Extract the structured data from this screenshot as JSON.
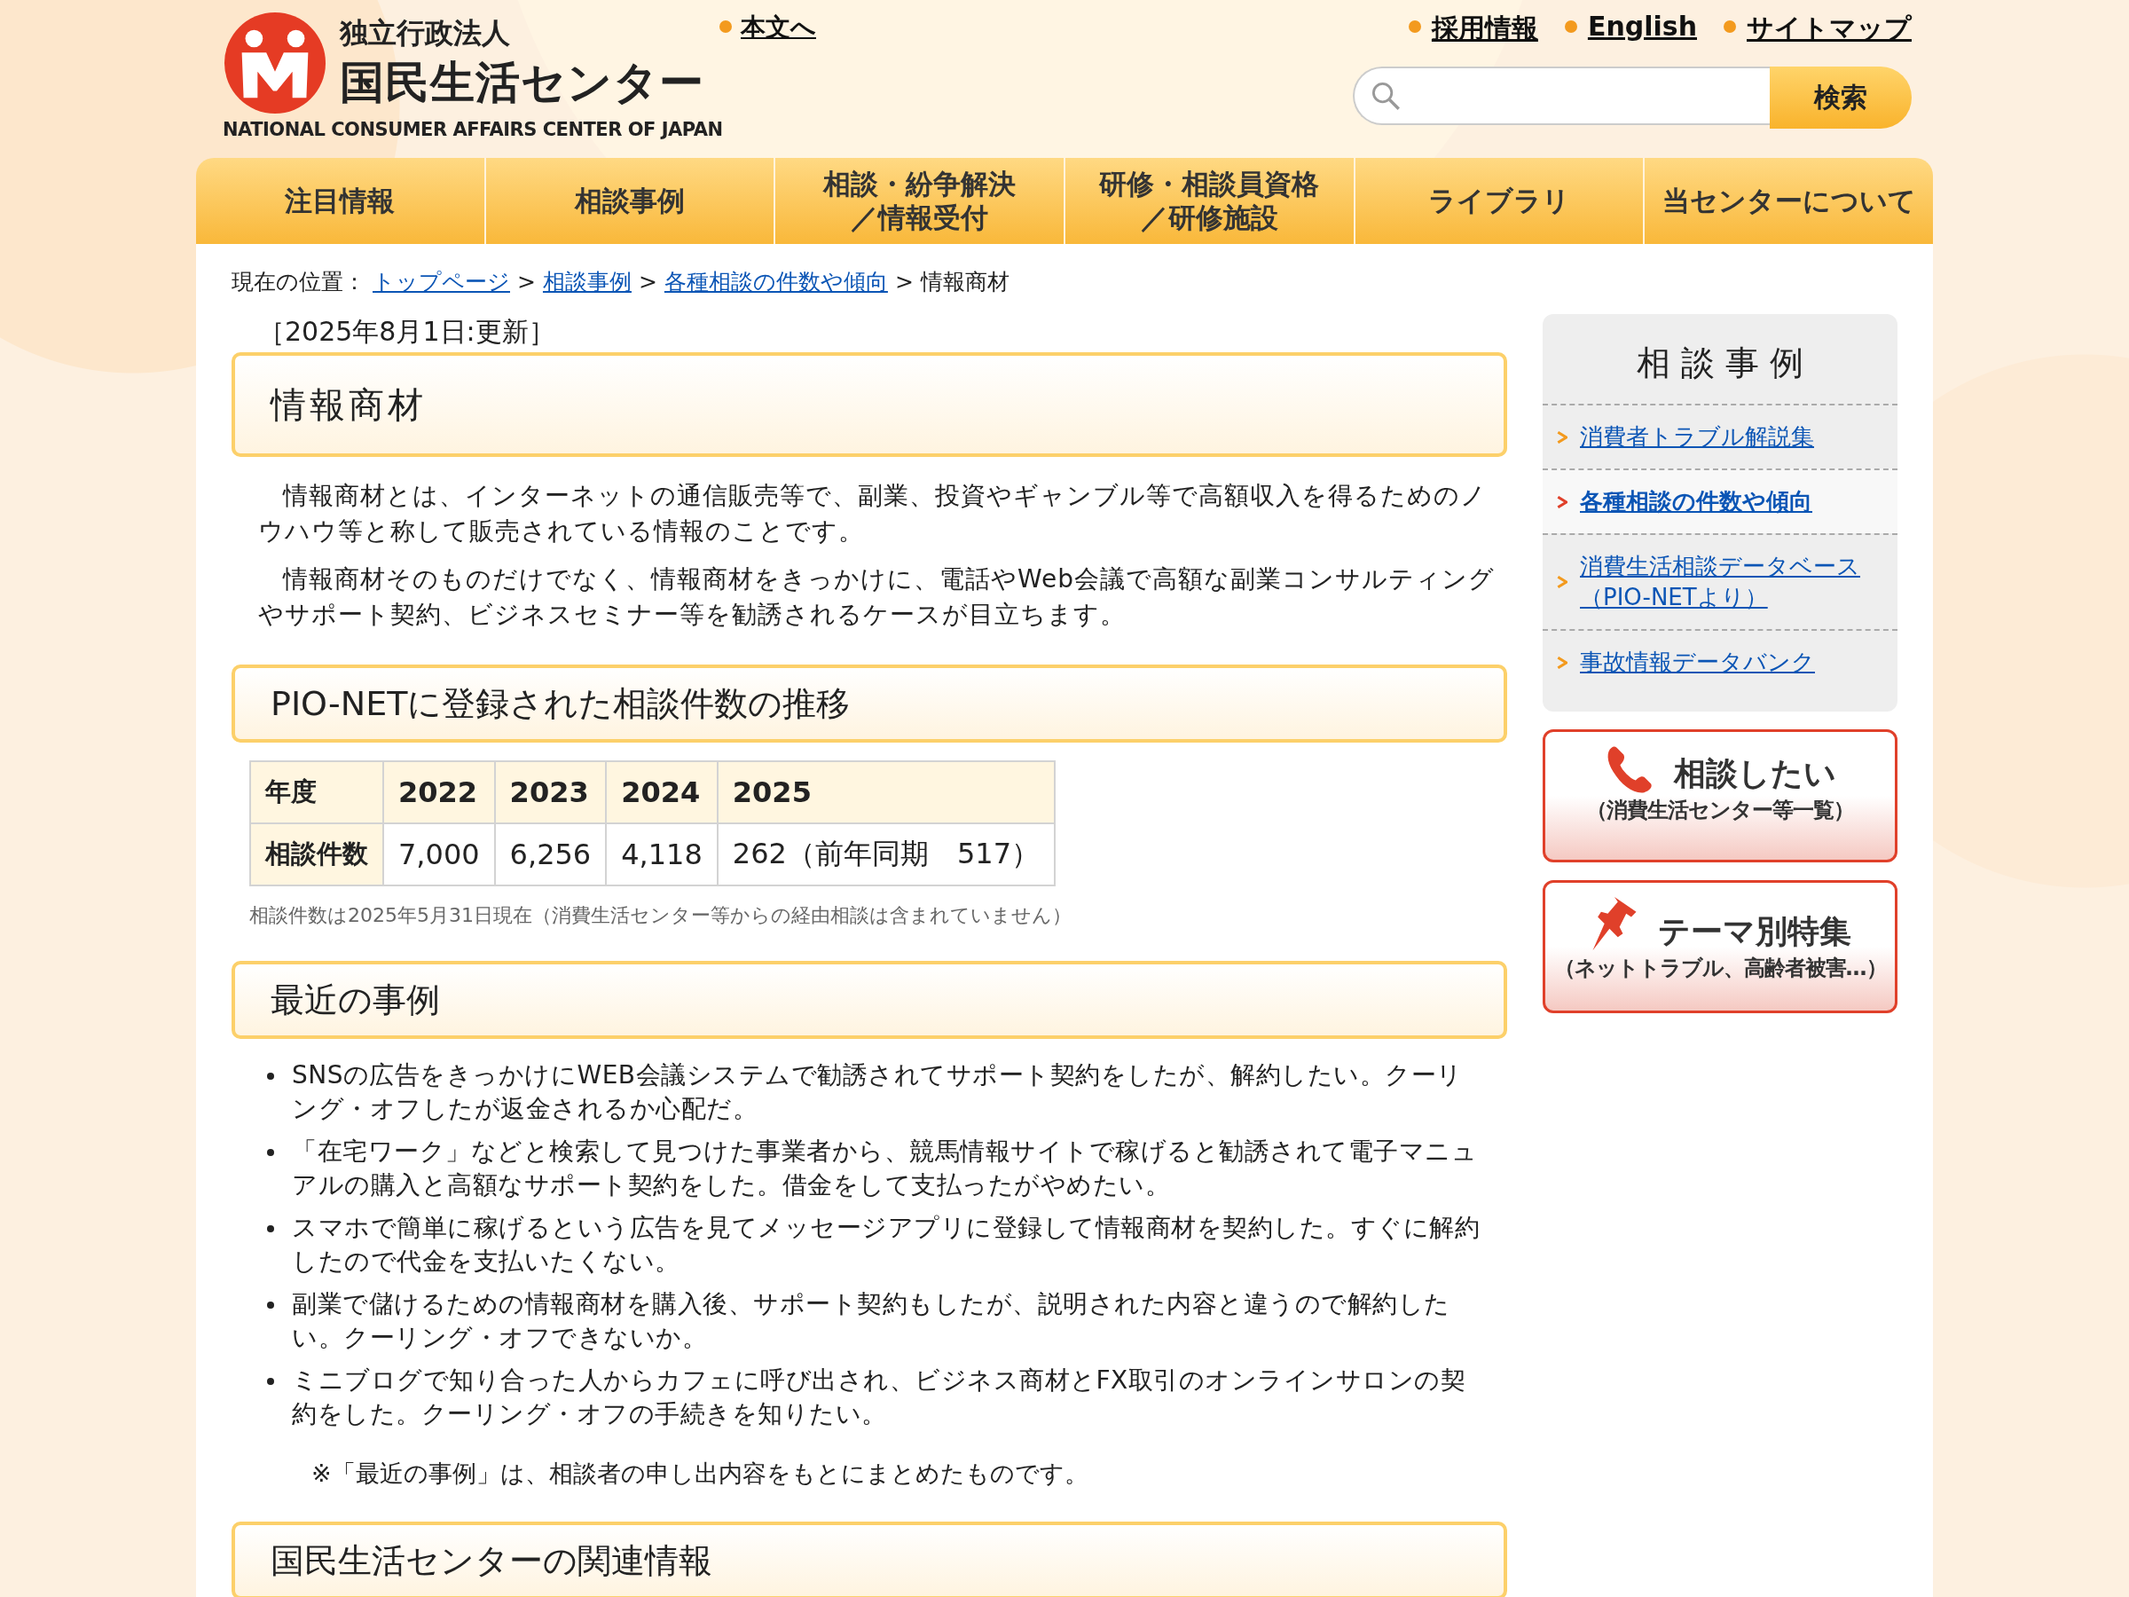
{
  "header": {
    "org_type": "独立行政法人",
    "org_name": "国民生活センター",
    "org_name_en": "NATIONAL CONSUMER AFFAIRS CENTER OF JAPAN",
    "skip_link": "本文へ",
    "utility_links": [
      "採用情報",
      "English",
      "サイトマップ"
    ],
    "search": {
      "button": "検索"
    }
  },
  "nav": [
    {
      "lines": [
        "注目情報"
      ]
    },
    {
      "lines": [
        "相談事例"
      ]
    },
    {
      "lines": [
        "相談・紛争解決",
        "／情報受付"
      ]
    },
    {
      "lines": [
        "研修・相談員資格",
        "／研修施設"
      ]
    },
    {
      "lines": [
        "ライブラリ"
      ]
    },
    {
      "lines": [
        "当センターについて"
      ]
    }
  ],
  "breadcrumb": {
    "label": "現在の位置：",
    "links": [
      "トップページ",
      "相談事例",
      "各種相談の件数や傾向"
    ],
    "separator": ">",
    "current": "情報商材"
  },
  "updated": "［2025年8月1日:更新］",
  "page_title": "情報商材",
  "intro": [
    "情報商材とは、インターネットの通信販売等で、副業、投資やギャンブル等で高額収入を得るためのノウハウ等と称して販売されている情報のことです。",
    "情報商材そのものだけでなく、情報商材をきっかけに、電話やWeb会議で高額な副業コンサルティングやサポート契約、ビジネスセミナー等を勧誘されるケースが目立ちます。"
  ],
  "sections": [
    {
      "kind": "table",
      "heading": "PIO-NETに登録された相談件数の推移",
      "table": {
        "columns": [
          "年度",
          "2022",
          "2023",
          "2024",
          "2025"
        ],
        "rows": [
          [
            "相談件数",
            "7,000",
            "6,256",
            "4,118",
            "262（前年同期　517）"
          ]
        ]
      },
      "note": "相談件数は2025年5月31日現在（消費生活センター等からの経由相談は含まれていません）"
    },
    {
      "kind": "list",
      "heading": "最近の事例",
      "items": [
        "SNSの広告をきっかけにWEB会議システムで勧誘されてサポート契約をしたが、解約したい。クーリング・オフしたが返金されるか心配だ。",
        "「在宅ワーク」などと検索して見つけた事業者から、競馬情報サイトで稼げると勧誘されて電子マニュアルの購入と高額なサポート契約をした。借金をして支払ったがやめたい。",
        "スマホで簡単に稼げるという広告を見てメッセージアプリに登録して情報商材を契約した。すぐに解約したので代金を支払いたくない。",
        "副業で儲けるための情報商材を購入後、サポート契約もしたが、説明された内容と違うので解約したい。クーリング・オフできないか。",
        "ミニブログで知り合った人からカフェに呼び出され、ビジネス商材とFX取引のオンラインサロンの契約をした。クーリング・オフの手続きを知りたい。"
      ],
      "note": "※「最近の事例」は、相談者の申し出内容をもとにまとめたものです。"
    },
    {
      "kind": "heading",
      "heading": "国民生活センターの関連情報"
    }
  ],
  "sidebar": {
    "title": "相 談 事 例",
    "items": [
      {
        "label": "消費者トラブル解説集",
        "selected": false
      },
      {
        "label": "各種相談の件数や傾向",
        "selected": true
      },
      {
        "label": "消費生活相談データベース（PIO-NETより）",
        "selected": false
      },
      {
        "label": "事故情報データバンク",
        "selected": false
      }
    ],
    "banners": [
      {
        "kind": "phone",
        "title": "相談したい",
        "subtitle": "（消費生活センター等一覧）"
      },
      {
        "kind": "pin",
        "title": "テーマ別特集",
        "subtitle": "（ネットトラブル、高齢者被害…）"
      }
    ]
  }
}
